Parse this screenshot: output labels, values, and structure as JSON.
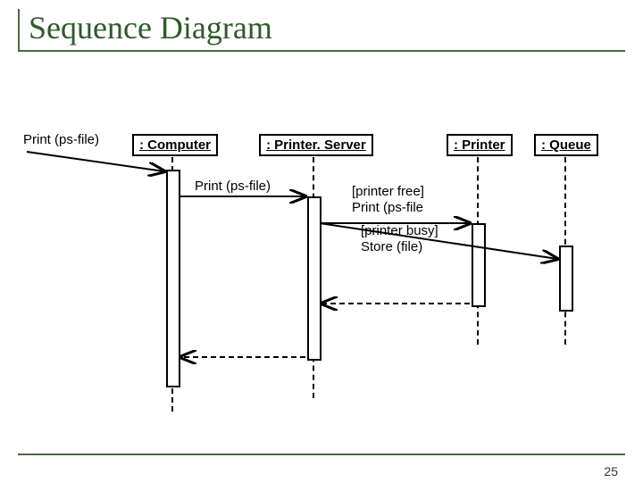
{
  "title": "Sequence Diagram",
  "page_number": "25",
  "actor": {
    "label": "Print (ps-file)"
  },
  "lifelines": {
    "computer": ": Computer",
    "printerserver": ": Printer. Server",
    "printer": ": Printer",
    "queue": ": Queue"
  },
  "messages": {
    "m1": "Print (ps-file)",
    "m2a": "[printer free]",
    "m2b": "Print (ps-file",
    "m3a": "[printer busy]",
    "m3b": "Store (file)"
  }
}
